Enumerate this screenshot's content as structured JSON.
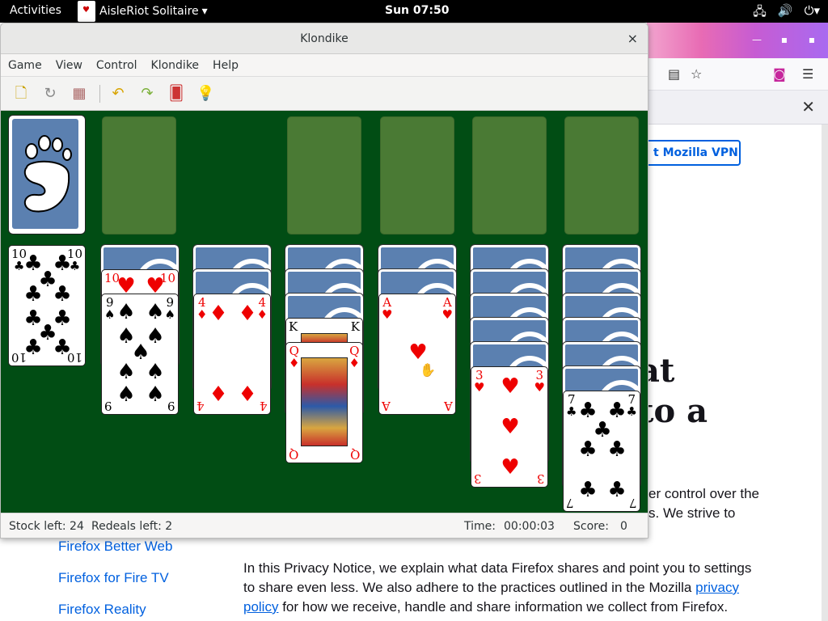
{
  "topbar": {
    "activities": "Activities",
    "app_name": "AisleRiot Solitaire",
    "app_arrow": "▾",
    "clock": "Sun 07:50",
    "tray_icons": [
      "network-icon",
      "volume-icon",
      "power-icon"
    ]
  },
  "firefox": {
    "vpn_button": "t Mozilla VPN",
    "heading_line1": "at",
    "heading_line2": "to a",
    "para1_line1": "er control over the",
    "para1_line2": "s. We strive to",
    "para2_line1": "In this Privacy Notice, we explain what data Firefox shares and point you to settings",
    "para2_line2": "to share even less. We also adhere to the practices outlined in the Mozilla ",
    "para2_link1": "privacy",
    "para2_line3_link": "policy",
    "para2_line3_rest": " for how we receive, handle and share information we collect from Firefox.",
    "side_links": [
      "Firefox Better Web",
      "Firefox for Fire TV",
      "Firefox Reality"
    ]
  },
  "window": {
    "title": "Klondike",
    "close": "×"
  },
  "menu": [
    "Game",
    "View",
    "Control",
    "Klondike",
    "Help"
  ],
  "toolbar": {
    "icons": [
      "new-game-icon",
      "restart-icon",
      "select-game-icon",
      "undo-icon",
      "redo-icon",
      "deal-icon",
      "hint-icon"
    ]
  },
  "status": {
    "stock_label": "Stock left: 24",
    "redeals_label": "Redeals left: 2",
    "time_label": "Time:",
    "time_value": "00:00:03",
    "score_label": "Score:",
    "score_value": "0"
  },
  "game": {
    "stock_remaining": 24,
    "redeals_remaining": 2,
    "tableau": [
      {
        "hidden": 0,
        "face_up": [
          "10♣"
        ]
      },
      {
        "hidden": 1,
        "face_up": [
          "10♥",
          "9♠"
        ]
      },
      {
        "hidden": 2,
        "face_up": [
          "4♦"
        ]
      },
      {
        "hidden": 3,
        "face_up": [
          "K♦",
          "Q♦"
        ]
      },
      {
        "hidden": 2,
        "face_up": [
          "A♥"
        ]
      },
      {
        "hidden": 5,
        "face_up": [
          "3♥"
        ]
      },
      {
        "hidden": 6,
        "face_up": [
          "7♣"
        ]
      }
    ],
    "cards": {
      "c10c": {
        "rank": "10",
        "suit": "♣"
      },
      "c10h": {
        "rank": "10",
        "suit": "♥"
      },
      "c9s": {
        "rank": "9",
        "suit": "♠"
      },
      "c4d": {
        "rank": "4",
        "suit": "♦"
      },
      "cKd": {
        "rank": "K",
        "suit": "♦"
      },
      "cQd": {
        "rank": "Q",
        "suit": "♦"
      },
      "cAh": {
        "rank": "A",
        "suit": "♥"
      },
      "c3h": {
        "rank": "3",
        "suit": "♥"
      },
      "c7c": {
        "rank": "7",
        "suit": "♣"
      }
    }
  }
}
